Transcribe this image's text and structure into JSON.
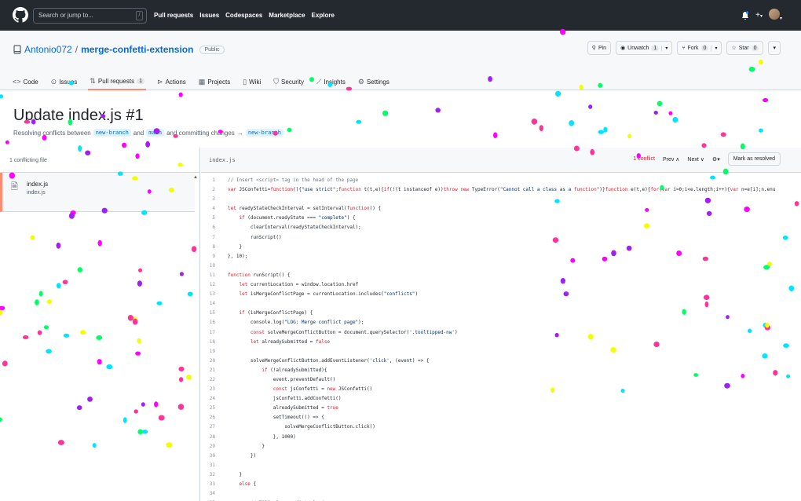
{
  "topbar": {
    "search_placeholder": "Search or jump to...",
    "search_shortcut": "/",
    "nav": [
      "Pull requests",
      "Issues",
      "Codespaces",
      "Marketplace",
      "Explore"
    ],
    "new_label": "+"
  },
  "repo": {
    "owner": "Antonio072",
    "separator": "/",
    "name": "merge-confetti-extension",
    "visibility": "Public",
    "pin_label": "Pin",
    "unwatch_label": "Unwatch",
    "unwatch_count": "1",
    "fork_label": "Fork",
    "fork_count": "0",
    "star_label": "Star",
    "star_count": "0",
    "tabs": [
      {
        "label": "Code",
        "icon": "code-icon"
      },
      {
        "label": "Issues",
        "icon": "issue-icon"
      },
      {
        "label": "Pull requests",
        "icon": "pull-request-icon",
        "count": "1"
      },
      {
        "label": "Actions",
        "icon": "play-icon"
      },
      {
        "label": "Projects",
        "icon": "table-icon"
      },
      {
        "label": "Wiki",
        "icon": "book-icon"
      },
      {
        "label": "Security",
        "icon": "shield-icon"
      },
      {
        "label": "Insights",
        "icon": "graph-icon"
      },
      {
        "label": "Settings",
        "icon": "gear-icon"
      }
    ]
  },
  "pr": {
    "title": "Update index.js #1",
    "sub_prefix": "Resolving conflicts between",
    "branch_a": "new-branch",
    "sub_and": "and",
    "branch_b": "main",
    "sub_commit": "and committing changes",
    "arrow": "→",
    "branch_c": "new-branch"
  },
  "files": {
    "header": "1 conflicting file",
    "items": [
      {
        "name": "index.js",
        "path": "index.js"
      }
    ]
  },
  "editor": {
    "filename": "index.js",
    "conflict_label": "1 conflict",
    "prev_label": "Prev",
    "next_label": "Next",
    "resolve_label": "Mark as resolved"
  },
  "code_lines": [
    "// Insert <script> tag in the head of the page",
    "var JSConfetti=function(){\"use strict\";function t(t,e){if(!(t instanceof e))throw new TypeError(\"Cannot call a class as a function\")}function e(t,e){for(var i=0;i<e.length;i++){var n=e[i];n.enu",
    "",
    "let readyStateCheckInterval = setInterval(function() {",
    "    if (document.readyState === \"complete\") {",
    "        clearInterval(readyStateCheckInterval);",
    "        runScript()",
    "    }",
    "}, 10);",
    "",
    "function runScript() {",
    "    let currentLocation = window.location.href",
    "    let isMergeConflictPage = currentLocation.includes(\"conflicts\")",
    "",
    "    if (isMergeConflictPage) {",
    "        console.log(\"LOG: Merge conflict page\");",
    "        const solveMergeConflictButton = document.querySelector('.tooltipped-nw')",
    "        let alreadySubmitted = false",
    "",
    "        solveMergeConflictButton.addEventListener('click', (event) => {",
    "            if (!alreadySubmitted){",
    "                event.preventDefault()",
    "                const jsConfetti = new JSConfetti()",
    "                jsConfetti.addConfetti()",
    "                alreadySubmitted = true",
    "                setTimeout(() => {",
    "                    solveMergeConflictButton.click()",
    "                }, 1000)",
    "            }",
    "        })",
    "",
    "    }",
    "    else {",
    "",
    "        // TODO: Remove dirty logic"
  ],
  "confetti_colors": [
    "#ff00ff",
    "#00e5ff",
    "#f2ff00",
    "#a020f0",
    "#00ff66",
    "#ff3399"
  ]
}
